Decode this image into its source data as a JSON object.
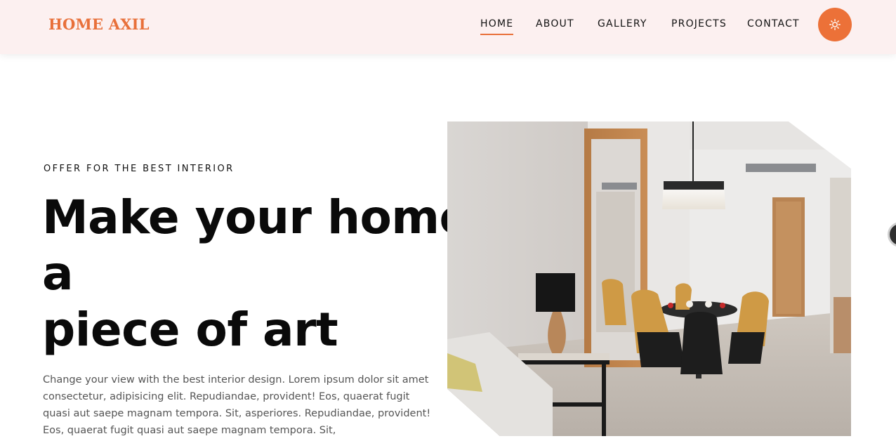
{
  "brand": {
    "logo_text": "HOME AXIL",
    "accent_color": "#e8703a"
  },
  "nav": {
    "items": [
      {
        "label": "HOME",
        "active": true
      },
      {
        "label": "ABOUT",
        "active": false
      },
      {
        "label": "GALLERY",
        "active": false
      },
      {
        "label": "PROJECTS",
        "active": false
      },
      {
        "label": "CONTACT",
        "active": false
      }
    ],
    "theme_toggle_icon": "sun-icon"
  },
  "hero": {
    "eyebrow": "OFFER FOR THE BEST INTERIOR",
    "headline_lines": [
      "Make your home",
      "a",
      "piece of art"
    ],
    "body": "Change your view with the best interior design. Lorem ipsum dolor sit amet consectetur, adipisicing elit. Repudiandae, provident! Eos, quaerat fugit quasi aut saepe magnam tempora. Sit, asperiores. Repudiandae, provident! Eos, quaerat fugit quasi aut saepe magnam tempora. Sit,",
    "image_icon": "dining-room-photo"
  },
  "colors": {
    "header_bg": "#fcf0f0",
    "button_bg": "#ec7138",
    "text": "#111111",
    "body_text": "#555555"
  }
}
